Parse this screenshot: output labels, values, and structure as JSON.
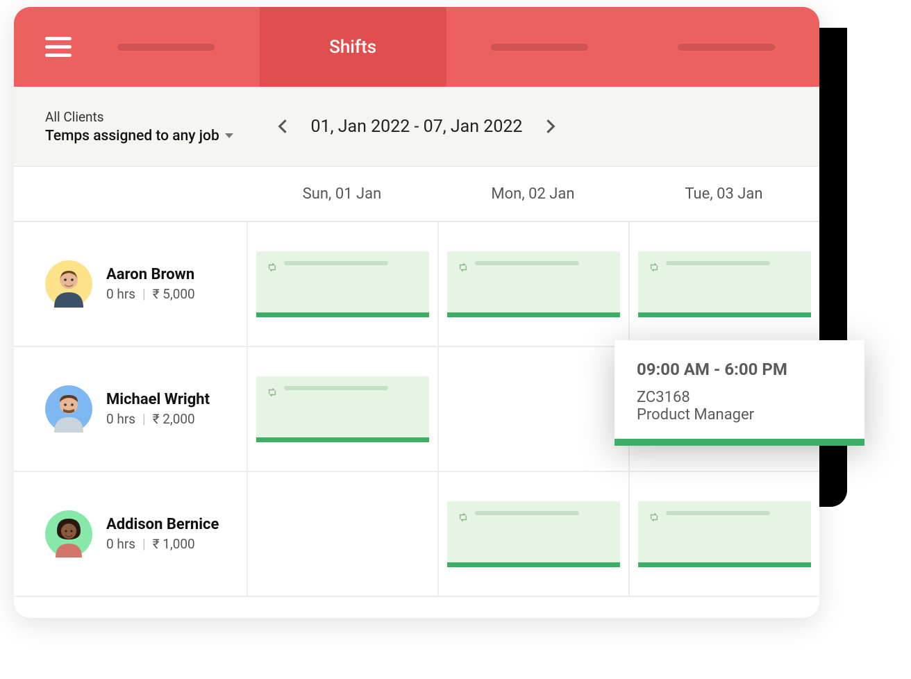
{
  "header": {
    "active_tab": "Shifts"
  },
  "filter": {
    "clients_label": "All Clients",
    "assignment_label": "Temps assigned to any job",
    "date_range": "01, Jan 2022 - 07, Jan 2022"
  },
  "columns": [
    "Sun, 01 Jan",
    "Mon, 02 Jan",
    "Tue, 03 Jan"
  ],
  "rows": [
    {
      "name": "Aaron Brown",
      "hours": "0 hrs",
      "amount": "₹ 5,000",
      "avatar_color": "yellow",
      "shifts": [
        true,
        true,
        true
      ]
    },
    {
      "name": "Michael Wright",
      "hours": "0 hrs",
      "amount": "₹ 2,000",
      "avatar_color": "blue",
      "shifts": [
        true,
        false,
        false
      ]
    },
    {
      "name": "Addison Bernice",
      "hours": "0 hrs",
      "amount": "₹ 1,000",
      "avatar_color": "green",
      "shifts": [
        false,
        true,
        true
      ]
    }
  ],
  "popup": {
    "time": "09:00 AM - 6:00 PM",
    "code": "ZC3168",
    "role": "Product Manager"
  }
}
